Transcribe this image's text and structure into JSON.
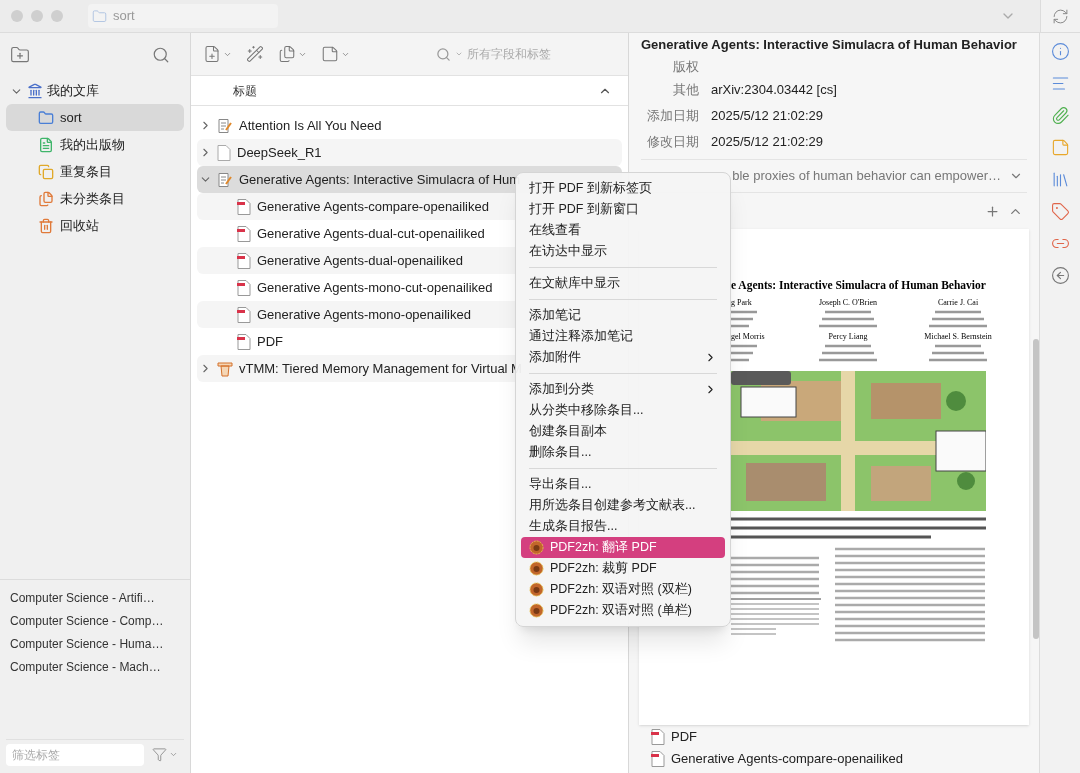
{
  "window": {
    "path": "sort"
  },
  "collections": [
    {
      "label": "我的文库",
      "kind": "library",
      "expanded": true,
      "selected": false,
      "children": [
        {
          "label": "sort",
          "kind": "folder",
          "selected": true
        },
        {
          "label": "我的出版物",
          "kind": "publications",
          "selected": false
        },
        {
          "label": "重复条目",
          "kind": "duplicates",
          "selected": false
        },
        {
          "label": "未分类条目",
          "kind": "unfiled",
          "selected": false
        },
        {
          "label": "回收站",
          "kind": "trash",
          "selected": false
        }
      ]
    }
  ],
  "tags": [
    "Computer Science - Artifi…",
    "Computer Science - Comp…",
    "Computer Science - Huma…",
    "Computer Science - Mach…"
  ],
  "tag_filter": {
    "placeholder": "筛选标签"
  },
  "search": {
    "placeholder": "所有字段和标签"
  },
  "items_table": {
    "columns": [
      "标题"
    ],
    "rows": [
      {
        "title": "Attention Is All You Need",
        "kind": "preprint",
        "expanded": false,
        "selected": false,
        "children": []
      },
      {
        "title": "DeepSeek_R1",
        "kind": "document",
        "expanded": false,
        "selected": false,
        "children": []
      },
      {
        "title": "Generative Agents: Interactive Simulacra of Hum",
        "kind": "preprint",
        "expanded": true,
        "selected": true,
        "children": [
          {
            "title": "Generative Agents-compare-openailiked",
            "kind": "pdf"
          },
          {
            "title": "Generative Agents-dual-cut-openailiked",
            "kind": "pdf"
          },
          {
            "title": "Generative Agents-dual-openailiked",
            "kind": "pdf"
          },
          {
            "title": "Generative Agents-mono-cut-openailiked",
            "kind": "pdf"
          },
          {
            "title": "Generative Agents-mono-openailiked",
            "kind": "pdf"
          },
          {
            "title": "PDF",
            "kind": "pdf"
          }
        ]
      },
      {
        "title": "vTMM: Tiered Memory Management for Virtual M",
        "kind": "conference",
        "expanded": false,
        "selected": false,
        "children": []
      }
    ]
  },
  "item_pane": {
    "title": "Generative Agents: Interactive Simulacra of Human Behavior",
    "fields": [
      {
        "label": "版权"
      },
      {
        "label": "其他",
        "value": "arXiv:2304.03442 [cs]"
      },
      {
        "label": "添加日期",
        "value": "2025/5/12 21:02:29"
      },
      {
        "label": "修改日期",
        "value": "2025/5/12 21:02:29"
      }
    ],
    "abstract": "ble proxies of human behavior can empower…",
    "attachments": [
      "PDF",
      "Generative Agents-compare-openailiked"
    ]
  },
  "preview": {
    "title": "e Agents: Interactive Simulacra of Human Behavior",
    "authors": [
      "g Park",
      "Joseph C. O'Brien",
      "Carrie J. Cai",
      "gel Morris",
      "Percy Liang",
      "Michael S. Bernstein"
    ],
    "figure": {
      "kind": "picture"
    }
  },
  "context_menu": {
    "groups": [
      [
        {
          "label": "打开 PDF 到新标签页",
          "kind": "plain",
          "submenu": false,
          "selected": false
        },
        {
          "label": "打开 PDF 到新窗口",
          "kind": "plain",
          "submenu": false,
          "selected": false
        },
        {
          "label": "在线查看",
          "kind": "plain",
          "submenu": false,
          "selected": false
        },
        {
          "label": "在访达中显示",
          "kind": "plain",
          "submenu": false,
          "selected": false
        }
      ],
      [
        {
          "label": "在文献库中显示",
          "kind": "plain",
          "submenu": false,
          "selected": false
        }
      ],
      [
        {
          "label": "添加笔记",
          "kind": "plain",
          "submenu": false,
          "selected": false
        },
        {
          "label": "通过注释添加笔记",
          "kind": "plain",
          "submenu": false,
          "selected": false
        },
        {
          "label": "添加附件",
          "kind": "plain",
          "submenu": true,
          "selected": false
        }
      ],
      [
        {
          "label": "添加到分类",
          "kind": "plain",
          "submenu": true,
          "selected": false
        },
        {
          "label": "从分类中移除条目...",
          "kind": "plain",
          "submenu": false,
          "selected": false
        },
        {
          "label": "创建条目副本",
          "kind": "plain",
          "submenu": false,
          "selected": false
        },
        {
          "label": "删除条目...",
          "kind": "plain",
          "submenu": false,
          "selected": false
        }
      ],
      [
        {
          "label": "导出条目...",
          "kind": "plain",
          "submenu": false,
          "selected": false
        },
        {
          "label": "用所选条目创建参考文献表...",
          "kind": "plain",
          "submenu": false,
          "selected": false
        },
        {
          "label": "生成条目报告...",
          "kind": "plain",
          "submenu": false,
          "selected": false
        },
        {
          "label": "PDF2zh: 翻译 PDF",
          "kind": "plugin",
          "submenu": false,
          "selected": true
        },
        {
          "label": "PDF2zh: 裁剪 PDF",
          "kind": "plugin",
          "submenu": false,
          "selected": false
        },
        {
          "label": "PDF2zh: 双语对照 (双栏)",
          "kind": "plugin",
          "submenu": false,
          "selected": false
        },
        {
          "label": "PDF2zh: 双语对照 (单栏)",
          "kind": "plugin",
          "submenu": false,
          "selected": false
        }
      ]
    ]
  }
}
